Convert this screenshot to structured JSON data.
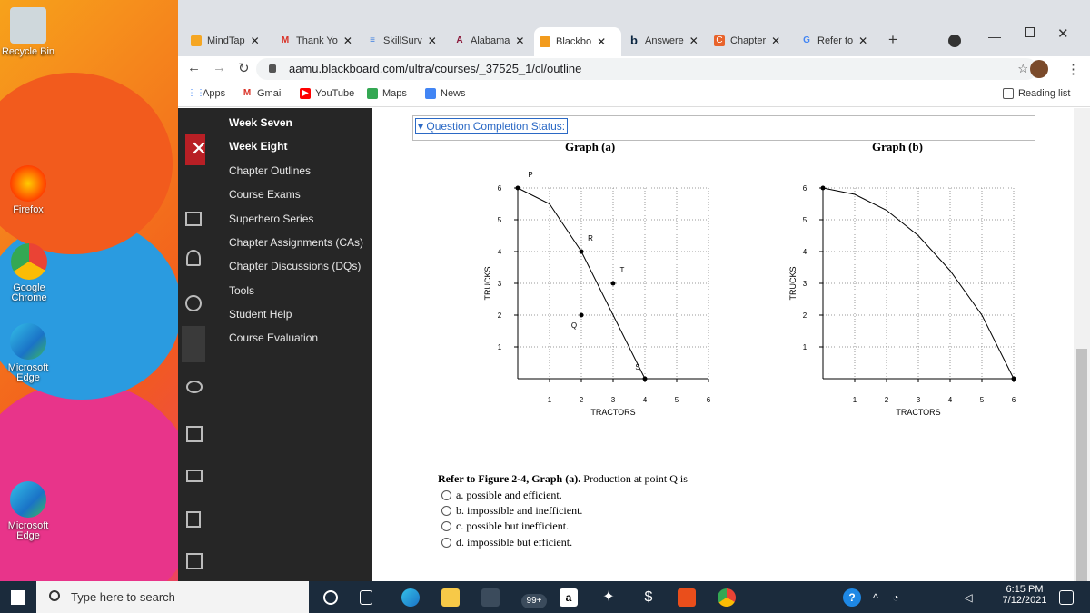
{
  "desktop": {
    "icons": [
      {
        "label": "Recycle Bin",
        "icon": "recycle-bin-icon"
      },
      {
        "label": "Firefox",
        "icon": "firefox-icon"
      },
      {
        "label": "Google Chrome",
        "icon": "chrome-icon"
      },
      {
        "label": "Microsoft Edge",
        "icon": "edge-icon"
      },
      {
        "label": "Microsoft Edge",
        "icon": "edge-icon"
      }
    ]
  },
  "tabs": [
    {
      "label": "MindTap",
      "color": "#f5a623"
    },
    {
      "label": "Thank Yo",
      "color": "#d93025"
    },
    {
      "label": "SkillSurv",
      "color": "#3f7fe0"
    },
    {
      "label": "Alabama",
      "color": "#8a1538"
    },
    {
      "label": "Blackbo",
      "color": "#f29b1d"
    },
    {
      "label": "Answere",
      "color": "#0a2540"
    },
    {
      "label": "Chapter",
      "color": "#e8632b"
    },
    {
      "label": "Refer to",
      "color": "#4285f4"
    }
  ],
  "address": {
    "url": "aamu.blackboard.com/ultra/courses/_37525_1/cl/outline"
  },
  "bookmarks": {
    "apps": "Apps",
    "gmail": "Gmail",
    "youtube": "YouTube",
    "maps": "Maps",
    "news": "News",
    "reading_list": "Reading list"
  },
  "menu": {
    "items": [
      "Week Seven",
      "Week Eight",
      "Chapter Outlines",
      "Course Exams",
      "Superhero Series",
      "Chapter Assignments (CAs)",
      "Chapter Discussions (DQs)",
      "Tools",
      "Student Help",
      "Course Evaluation"
    ]
  },
  "question_status": "Question Completion Status:",
  "chart_data": [
    {
      "type": "line",
      "title": "Graph (a)",
      "xlabel": "TRACTORS",
      "ylabel": "TRUCKS",
      "xlim": [
        0,
        6
      ],
      "ylim": [
        0,
        6
      ],
      "grid": true,
      "x": [
        0,
        1,
        2,
        3,
        4
      ],
      "y": [
        6,
        5.5,
        4,
        2,
        0
      ],
      "points": [
        {
          "label": "P",
          "x": 0,
          "y": 6
        },
        {
          "label": "R",
          "x": 2,
          "y": 4
        },
        {
          "label": "T",
          "x": 3,
          "y": 3
        },
        {
          "label": "Q",
          "x": 2,
          "y": 2
        },
        {
          "label": "S",
          "x": 4,
          "y": 0
        }
      ]
    },
    {
      "type": "line",
      "title": "Graph (b)",
      "xlabel": "TRACTORS",
      "ylabel": "TRUCKS",
      "xlim": [
        0,
        6
      ],
      "ylim": [
        0,
        6
      ],
      "grid": true,
      "x": [
        0,
        1,
        2,
        3,
        4,
        5,
        6
      ],
      "y": [
        6,
        5.8,
        5.3,
        4.5,
        3.4,
        2,
        0
      ],
      "points": [
        {
          "label": "",
          "x": 0,
          "y": 6
        },
        {
          "label": "",
          "x": 6,
          "y": 0
        }
      ]
    }
  ],
  "question": {
    "prefix": "Refer to Figure 2-4, Graph (a).",
    "text": "Production at point Q is",
    "options": [
      "a. possible and efficient.",
      "b. impossible and inefficient.",
      "c. possible but inefficient.",
      "d. impossible but efficient."
    ]
  },
  "taskbar": {
    "search_placeholder": "Type here to search",
    "badge": "99+",
    "time": "6:15 PM",
    "date": "7/12/2021"
  }
}
